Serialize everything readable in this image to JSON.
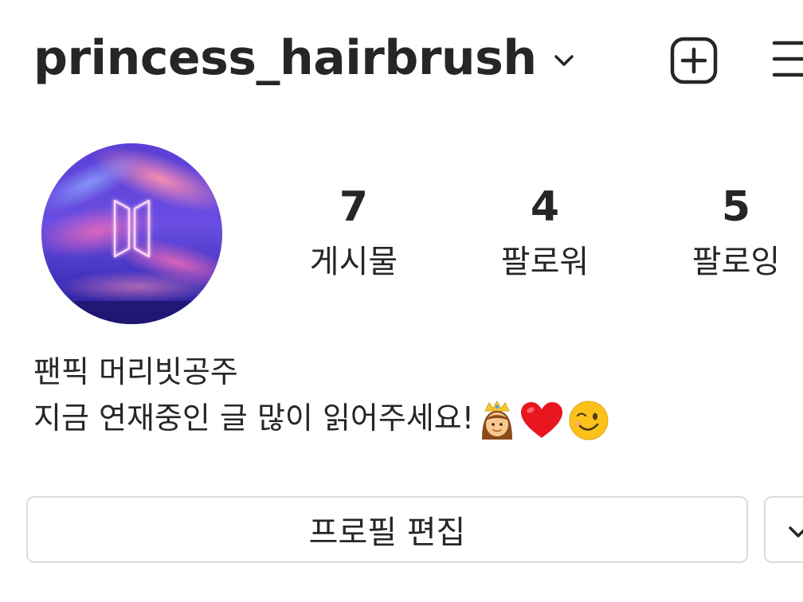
{
  "header": {
    "username": "princess_hairbrush",
    "icons": {
      "account_switcher": "chevron-down-icon",
      "new_post": "add-square-icon",
      "menu": "hamburger-menu-icon"
    }
  },
  "profile": {
    "avatar": {
      "description_icon": "bts-logo-icon"
    },
    "stats": [
      {
        "count": "7",
        "label": "게시물"
      },
      {
        "count": "4",
        "label": "팔로워"
      },
      {
        "count": "5",
        "label": "팔로잉"
      }
    ]
  },
  "bio": {
    "line1": "팬픽 머리빗공주",
    "line2": "지금 연재중인 글 많이 읽어주세요!",
    "emojis": [
      "princess-emoji",
      "red-heart-emoji",
      "winking-face-emoji"
    ]
  },
  "actions": {
    "edit_profile_label": "프로필 편집",
    "suggest_icon": "chevron-down-icon"
  },
  "colors": {
    "text": "#262626",
    "border": "#dbdbdb",
    "background": "#ffffff"
  }
}
